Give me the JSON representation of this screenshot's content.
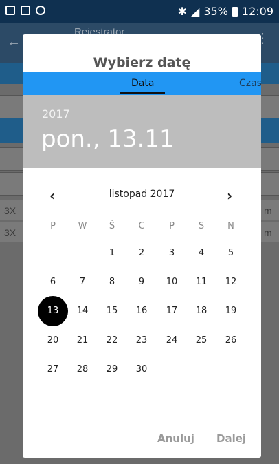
{
  "status_bar": {
    "battery": "35%",
    "time": "12:09"
  },
  "background_app": {
    "title": "Rejestrator",
    "rows": [
      {
        "left": "3X",
        "right": "m"
      },
      {
        "left": "3X",
        "right": "m"
      }
    ]
  },
  "dialog": {
    "title": "Wybierz datę",
    "tabs": [
      {
        "label": "Data",
        "active": true
      },
      {
        "label": "Czas",
        "active": false
      }
    ],
    "year": "2017",
    "selected_date": "pon., 13.11",
    "month_label": "listopad 2017",
    "weekdays": [
      "P",
      "W",
      "Ś",
      "C",
      "P",
      "S",
      "N"
    ],
    "weeks": [
      [
        "",
        "",
        "1",
        "2",
        "3",
        "4",
        "5"
      ],
      [
        "6",
        "7",
        "8",
        "9",
        "10",
        "11",
        "12"
      ],
      [
        "13",
        "14",
        "15",
        "16",
        "17",
        "18",
        "19"
      ],
      [
        "20",
        "21",
        "22",
        "23",
        "24",
        "25",
        "26"
      ],
      [
        "27",
        "28",
        "29",
        "30",
        "",
        "",
        ""
      ]
    ],
    "selected_day": "13",
    "cancel_label": "Anuluj",
    "next_label": "Dalej"
  },
  "colors": {
    "accent": "#2196f3",
    "header_bg": "#bdbdbd",
    "selected_day": "#000000"
  }
}
